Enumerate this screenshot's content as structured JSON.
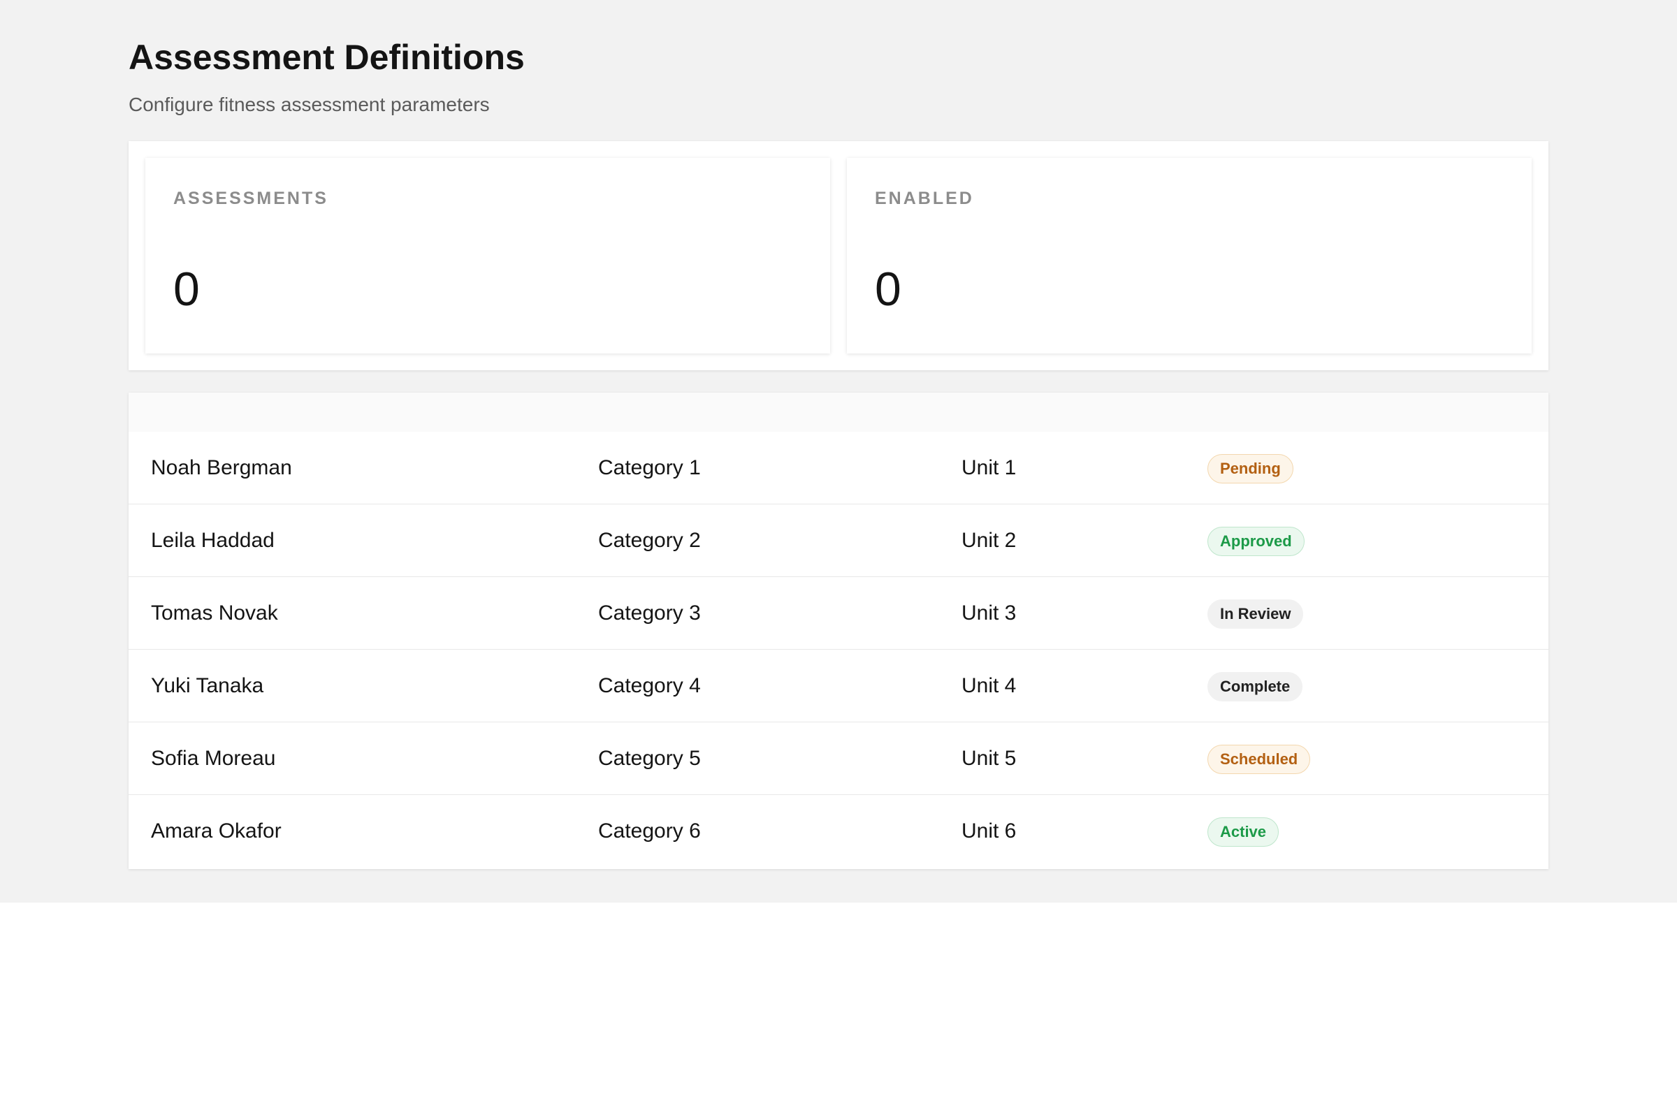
{
  "header": {
    "title": "Assessment Definitions",
    "subtitle": "Configure fitness assessment parameters"
  },
  "stats": [
    {
      "label": "ASSESSMENTS",
      "value": "0"
    },
    {
      "label": "ENABLED",
      "value": "0"
    }
  ],
  "table": {
    "rows": [
      {
        "name": "Noah Bergman",
        "category": "Category 1",
        "unit": "Unit 1",
        "status": "Pending"
      },
      {
        "name": "Leila Haddad",
        "category": "Category 2",
        "unit": "Unit 2",
        "status": "Approved"
      },
      {
        "name": "Tomas Novak",
        "category": "Category 3",
        "unit": "Unit 3",
        "status": "In Review"
      },
      {
        "name": "Yuki Tanaka",
        "category": "Category 4",
        "unit": "Unit 4",
        "status": "Complete"
      },
      {
        "name": "Sofia Moreau",
        "category": "Category 5",
        "unit": "Unit 5",
        "status": "Scheduled"
      },
      {
        "name": "Amara Okafor",
        "category": "Category 6",
        "unit": "Unit 6",
        "status": "Active"
      }
    ]
  },
  "colors": {
    "page_background": "#f2f2f2",
    "badge_warning_text": "#b36012",
    "badge_success_text": "#1c9a48",
    "badge_neutral_text": "#222222"
  }
}
